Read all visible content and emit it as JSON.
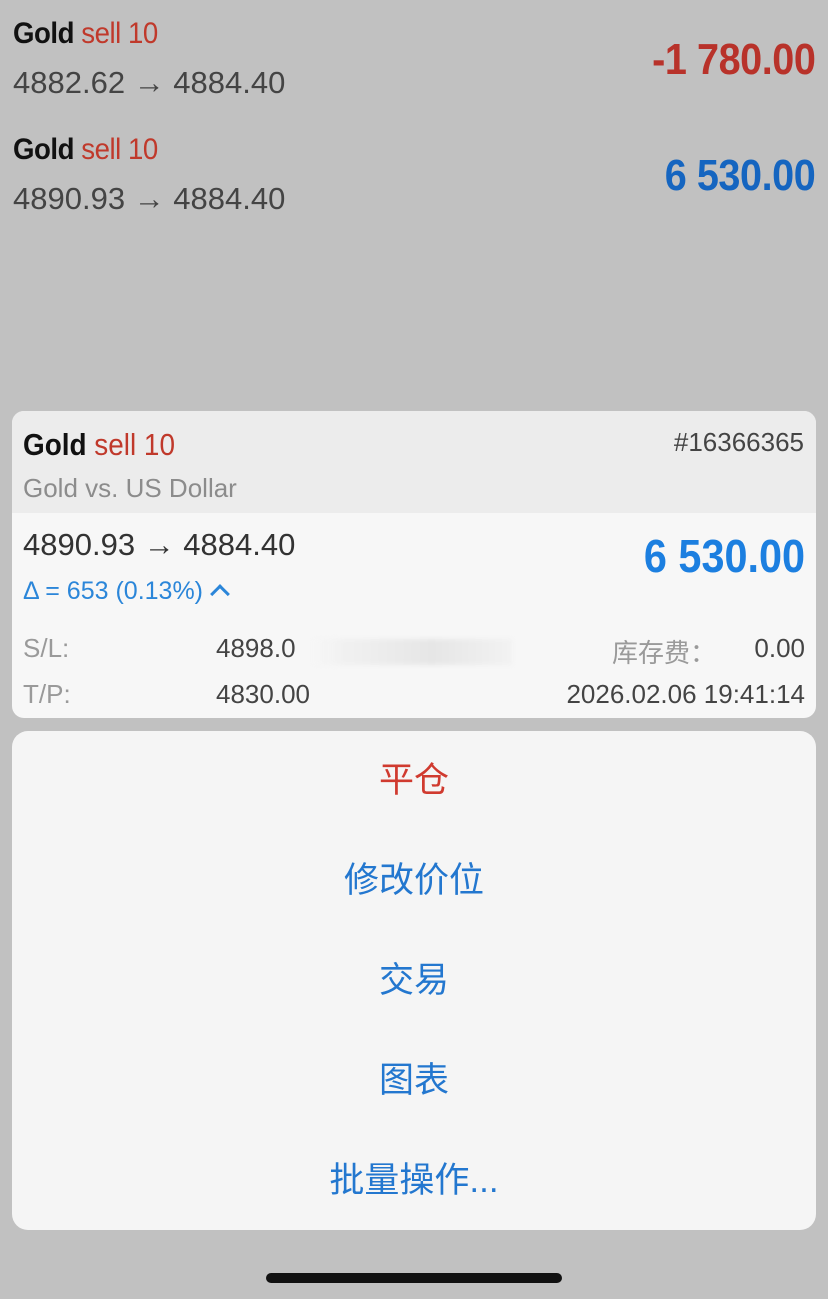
{
  "positions": [
    {
      "symbol": "Gold",
      "side": "sell 10",
      "prices": "4882.62 → 4884.40",
      "profit": "-1 780.00",
      "profit_color": "#b8322a"
    },
    {
      "symbol": "Gold",
      "side": "sell 10",
      "prices": "4890.93 → 4884.40",
      "profit": "6 530.00",
      "profit_color": "#1565c0"
    }
  ],
  "detail": {
    "symbol": "Gold",
    "side": "sell 10",
    "ticket": "#16366365",
    "description": "Gold vs. US Dollar",
    "prices": "4890.93 → 4884.40",
    "profit": "6 530.00",
    "delta": "Δ = 653 (0.13%)",
    "sl_label": "S/L:",
    "sl_value": "4898.0",
    "tp_label": "T/P:",
    "tp_value": "4830.00",
    "swap_label": "库存费：",
    "swap_value": "0.00",
    "open_time": "2026.02.06 19:41:14"
  },
  "actions": [
    {
      "label": "平仓",
      "style": "destructive"
    },
    {
      "label": "修改价位",
      "style": "default"
    },
    {
      "label": "交易",
      "style": "default"
    },
    {
      "label": "图表",
      "style": "default"
    },
    {
      "label": "批量操作...",
      "style": "default"
    }
  ]
}
